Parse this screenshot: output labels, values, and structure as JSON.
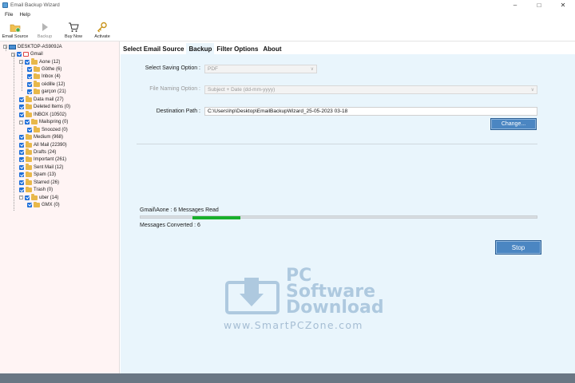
{
  "window": {
    "title": "Email Backup Wizard"
  },
  "menu": [
    "File",
    "Help"
  ],
  "toolbar": [
    {
      "label": "Email Source",
      "icon": "email-source-icon",
      "enabled": true
    },
    {
      "label": "Backup",
      "icon": "play-icon",
      "enabled": false
    },
    {
      "label": "Buy Now",
      "icon": "cart-icon",
      "enabled": true
    },
    {
      "label": "Activate",
      "icon": "key-icon",
      "enabled": true
    }
  ],
  "tree": [
    {
      "label": "DESKTOP-AS909JA",
      "level": 0,
      "kind": "pc",
      "expander": "-",
      "checkbox": false
    },
    {
      "label": "Gmail",
      "level": 1,
      "kind": "gmail",
      "expander": "-",
      "checkbox": true
    },
    {
      "label": "Aone (12)",
      "level": 2,
      "kind": "folder",
      "expander": "-",
      "checkbox": true
    },
    {
      "label": "Göthe (6)",
      "level": 3,
      "kind": "folder",
      "expander": "",
      "checkbox": true
    },
    {
      "label": "Inbox (4)",
      "level": 3,
      "kind": "folder",
      "expander": "",
      "checkbox": true
    },
    {
      "label": "cédille (12)",
      "level": 3,
      "kind": "folder",
      "expander": "",
      "checkbox": true
    },
    {
      "label": "garçon (21)",
      "level": 3,
      "kind": "folder",
      "expander": "",
      "checkbox": true
    },
    {
      "label": "Data mail (27)",
      "level": 2,
      "kind": "folder",
      "expander": "",
      "checkbox": true
    },
    {
      "label": "Deleted Items (0)",
      "level": 2,
      "kind": "deleted",
      "expander": "",
      "checkbox": true
    },
    {
      "label": "INBOX (10502)",
      "level": 2,
      "kind": "inbox",
      "expander": "",
      "checkbox": true
    },
    {
      "label": "Mailspring (0)",
      "level": 2,
      "kind": "folder",
      "expander": "-",
      "checkbox": true
    },
    {
      "label": "Snoozed (0)",
      "level": 3,
      "kind": "folder",
      "expander": "",
      "checkbox": true
    },
    {
      "label": "Medium (968)",
      "level": 2,
      "kind": "folder",
      "expander": "",
      "checkbox": true
    },
    {
      "label": "All Mail (22390)",
      "level": 2,
      "kind": "folder",
      "expander": "",
      "checkbox": true
    },
    {
      "label": "Drafts (24)",
      "level": 2,
      "kind": "drafts",
      "expander": "",
      "checkbox": true
    },
    {
      "label": "Important (261)",
      "level": 2,
      "kind": "folder",
      "expander": "",
      "checkbox": true
    },
    {
      "label": "Sent Mail (12)",
      "level": 2,
      "kind": "folder",
      "expander": "",
      "checkbox": true
    },
    {
      "label": "Spam (13)",
      "level": 2,
      "kind": "folder",
      "expander": "",
      "checkbox": true
    },
    {
      "label": "Starred (26)",
      "level": 2,
      "kind": "folder",
      "expander": "",
      "checkbox": true
    },
    {
      "label": "Trash (0)",
      "level": 2,
      "kind": "trash",
      "expander": "",
      "checkbox": true
    },
    {
      "label": "uber (14)",
      "level": 2,
      "kind": "folder",
      "expander": "-",
      "checkbox": true
    },
    {
      "label": "GMX (0)",
      "level": 3,
      "kind": "folder",
      "expander": "",
      "checkbox": true
    }
  ],
  "tabs": [
    {
      "label": "Select Email Source",
      "active": false
    },
    {
      "label": "Backup",
      "active": true
    },
    {
      "label": "Filter Options",
      "active": false
    },
    {
      "label": "About",
      "active": false
    }
  ],
  "backup": {
    "saving_option_label": "Select Saving Option :",
    "saving_option_value": "PDF",
    "naming_option_label": "File Naming Option :",
    "naming_option_value": "Subject + Date (dd-mm-yyyy)",
    "destination_label": "Destination Path :",
    "destination_value": "C:\\Users\\hp\\Desktop\\EmailBackupWizard_25-05-2023 03-18",
    "change_button": "Change...",
    "status_text": "Gmail\\Aone : 6 Messages Read",
    "progress_fraction": 0.12,
    "converted_text": "Messages Converted : 6",
    "stop_button": "Stop"
  },
  "watermark": {
    "line1": "PC",
    "line2": "Software",
    "line3": "Download",
    "url": "www.SmartPCZone.com"
  },
  "colors": {
    "accent": "#1e6fd9",
    "button": "#4b86c2",
    "progress": "#17b02b",
    "sidebar_bg": "#fff4f4",
    "panel_bg": "#e9f5fc",
    "statusbar": "#6a7784"
  }
}
